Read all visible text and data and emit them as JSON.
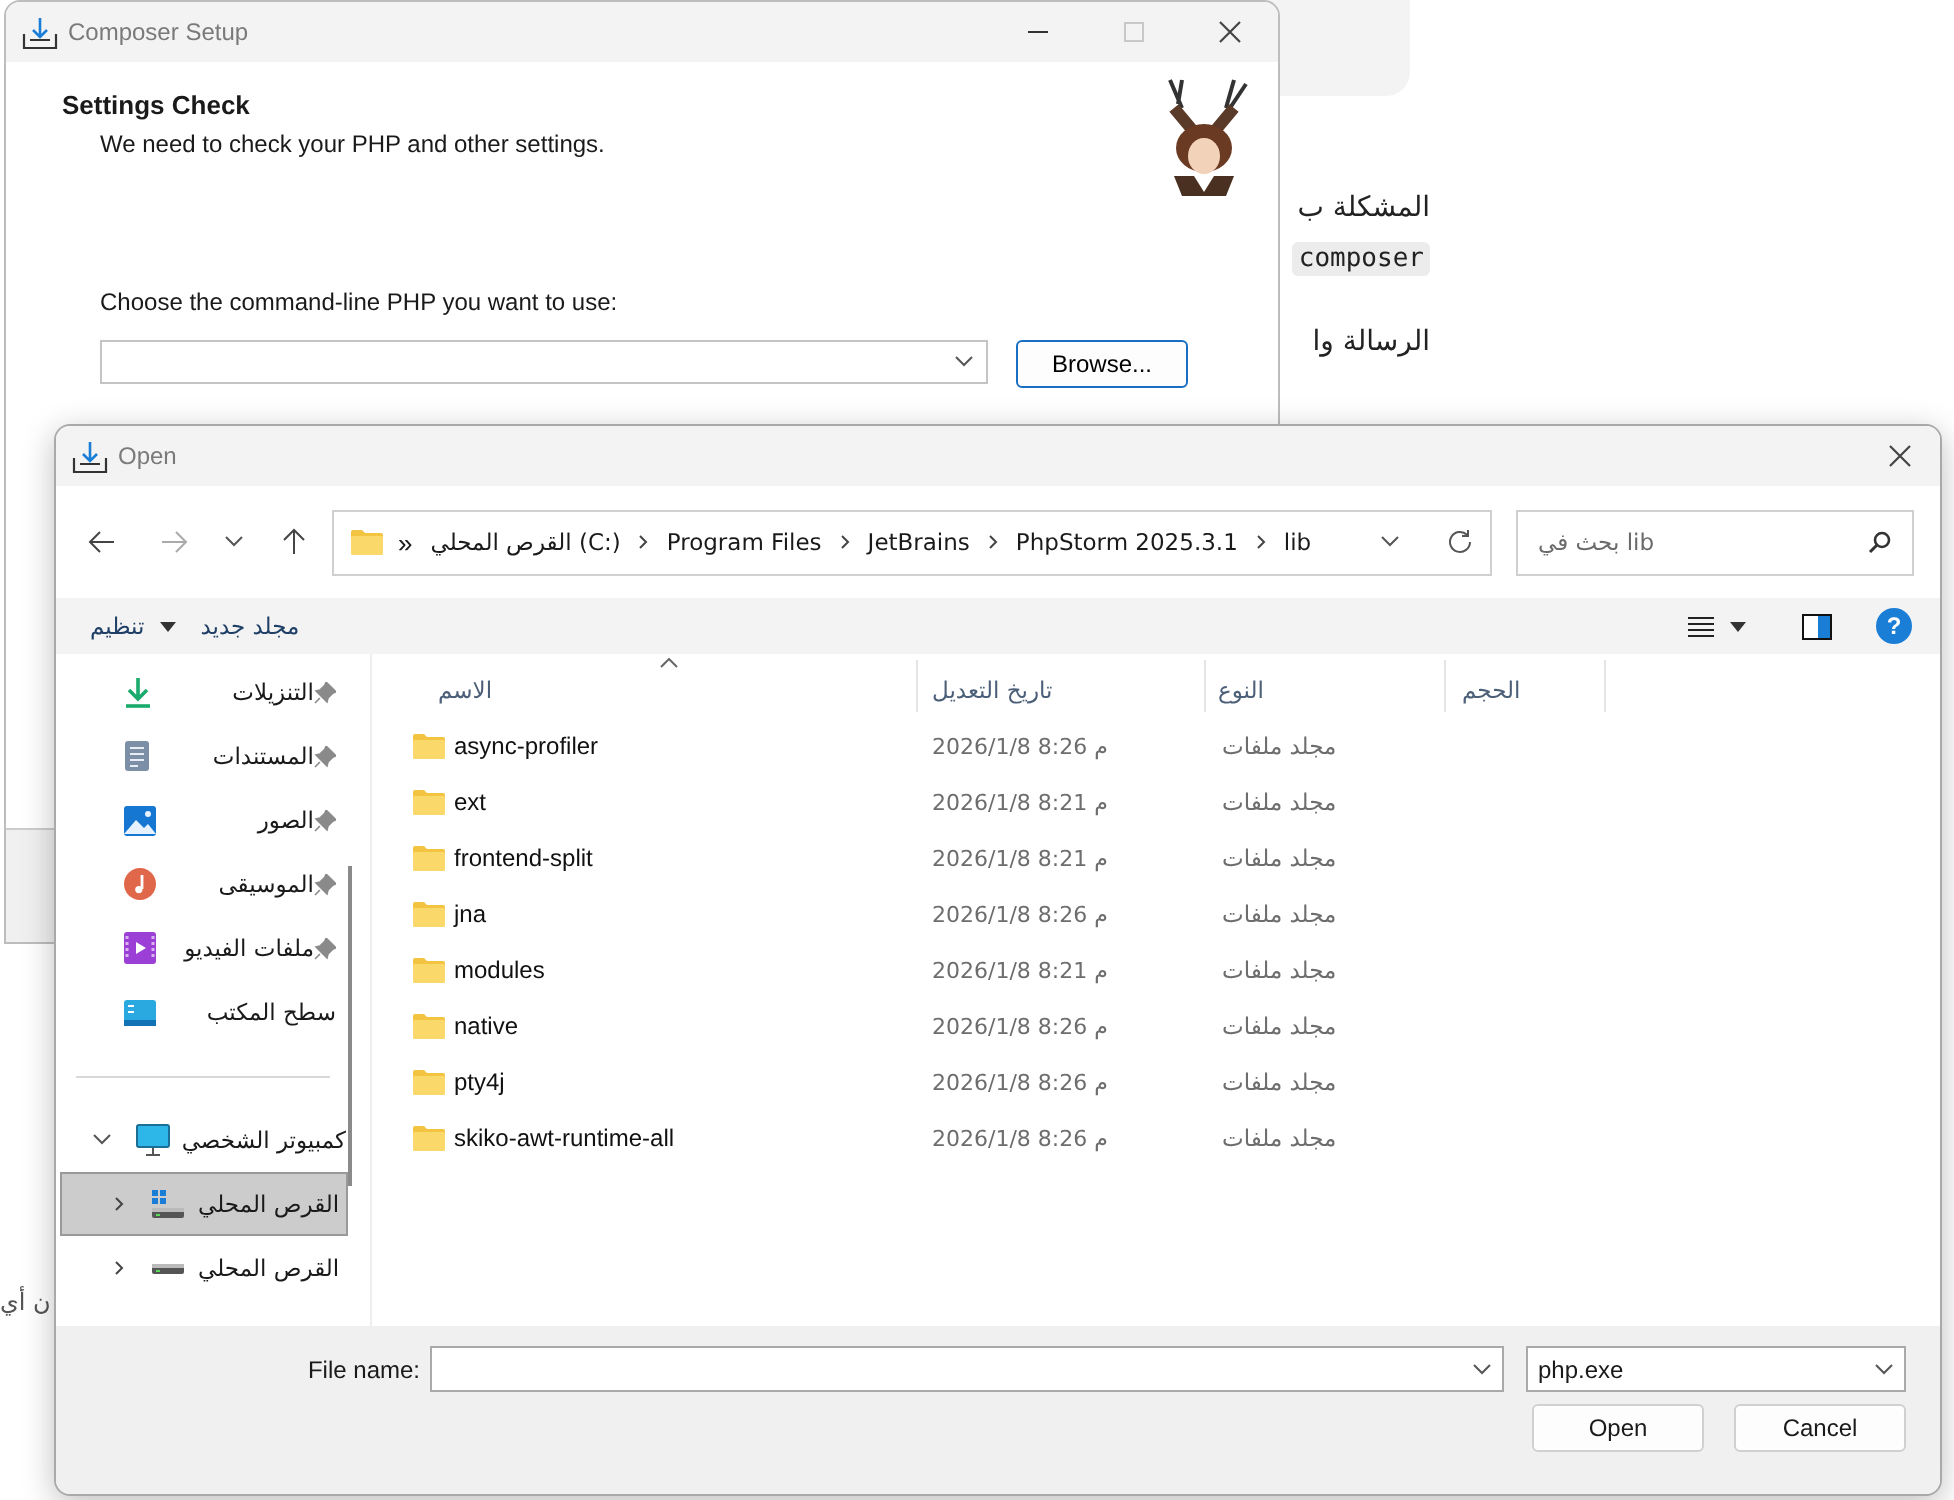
{
  "background_page": {
    "paragraph_1": "المشكلة ب",
    "code": "composer",
    "paragraph_2": "الرسالة وا",
    "fragment": "ن أي"
  },
  "composer_window": {
    "title": "Composer Setup",
    "maximize_disabled": true,
    "heading": "Settings Check",
    "subtitle": "We need to check your PHP and other settings.",
    "php_label": "Choose the command-line PHP you want to use:",
    "browse_button": "Browse..."
  },
  "open_dialog": {
    "title": "Open",
    "overflow": "»",
    "breadcrumb": [
      "lib",
      "PhpStorm 2025.3.1",
      "JetBrains",
      "Program Files",
      "القرص المحلي (C:)"
    ],
    "search": {
      "placeholder": "lib بحث في"
    },
    "commands": [
      {
        "label": "مجلد جديد",
        "has_menu": false
      },
      {
        "label": "تنظيم",
        "has_menu": true
      }
    ],
    "help_button": "?",
    "quick_access": [
      {
        "label": "التنزيلات",
        "kind": "downloads",
        "pinned": true
      },
      {
        "label": "المستندات",
        "kind": "documents",
        "pinned": true
      },
      {
        "label": "الصور",
        "kind": "pictures",
        "pinned": true
      },
      {
        "label": "الموسيقى",
        "kind": "music",
        "pinned": true
      },
      {
        "label": "ملفات الفيديو",
        "kind": "videos",
        "pinned": true
      },
      {
        "label": "سطح المكتب",
        "kind": "desktop",
        "pinned": false
      }
    ],
    "nav_tree": [
      {
        "label": "كمبيوتر الشخصي",
        "kind": "computer",
        "expanded": true,
        "selected": false,
        "children": [
          {
            "label": "القرص المحلي",
            "kind": "system_drive",
            "expanded": false,
            "selected": true
          },
          {
            "label": "القرص المحلي",
            "kind": "drive",
            "expanded": false,
            "selected": false
          }
        ]
      }
    ],
    "columns": [
      {
        "label": "الحجم",
        "sorted": false
      },
      {
        "label": "النوع",
        "sorted": false
      },
      {
        "label": "تاريخ التعديل",
        "sorted": false
      },
      {
        "label": "الاسم",
        "sorted": true
      }
    ],
    "rows": [
      {
        "name": "async-profiler",
        "modified": "2026/1/8 م 8:26",
        "type": "مجلد ملفات"
      },
      {
        "name": "ext",
        "modified": "2026/1/8 م 8:21",
        "type": "مجلد ملفات"
      },
      {
        "name": "frontend-split",
        "modified": "2026/1/8 م 8:21",
        "type": "مجلد ملفات"
      },
      {
        "name": "jna",
        "modified": "2026/1/8 م 8:26",
        "type": "مجلد ملفات"
      },
      {
        "name": "modules",
        "modified": "2026/1/8 م 8:21",
        "type": "مجلد ملفات"
      },
      {
        "name": "native",
        "modified": "2026/1/8 م 8:26",
        "type": "مجلد ملفات"
      },
      {
        "name": "pty4j",
        "modified": "2026/1/8 م 8:26",
        "type": "مجلد ملفات"
      },
      {
        "name": "skiko-awt-runtime-all",
        "modified": "2026/1/8 م 8:26",
        "type": "مجلد ملفات"
      }
    ],
    "file_name_label": "File name:",
    "file_type": "php.exe",
    "buttons": [
      "Cancel",
      "Open"
    ]
  }
}
